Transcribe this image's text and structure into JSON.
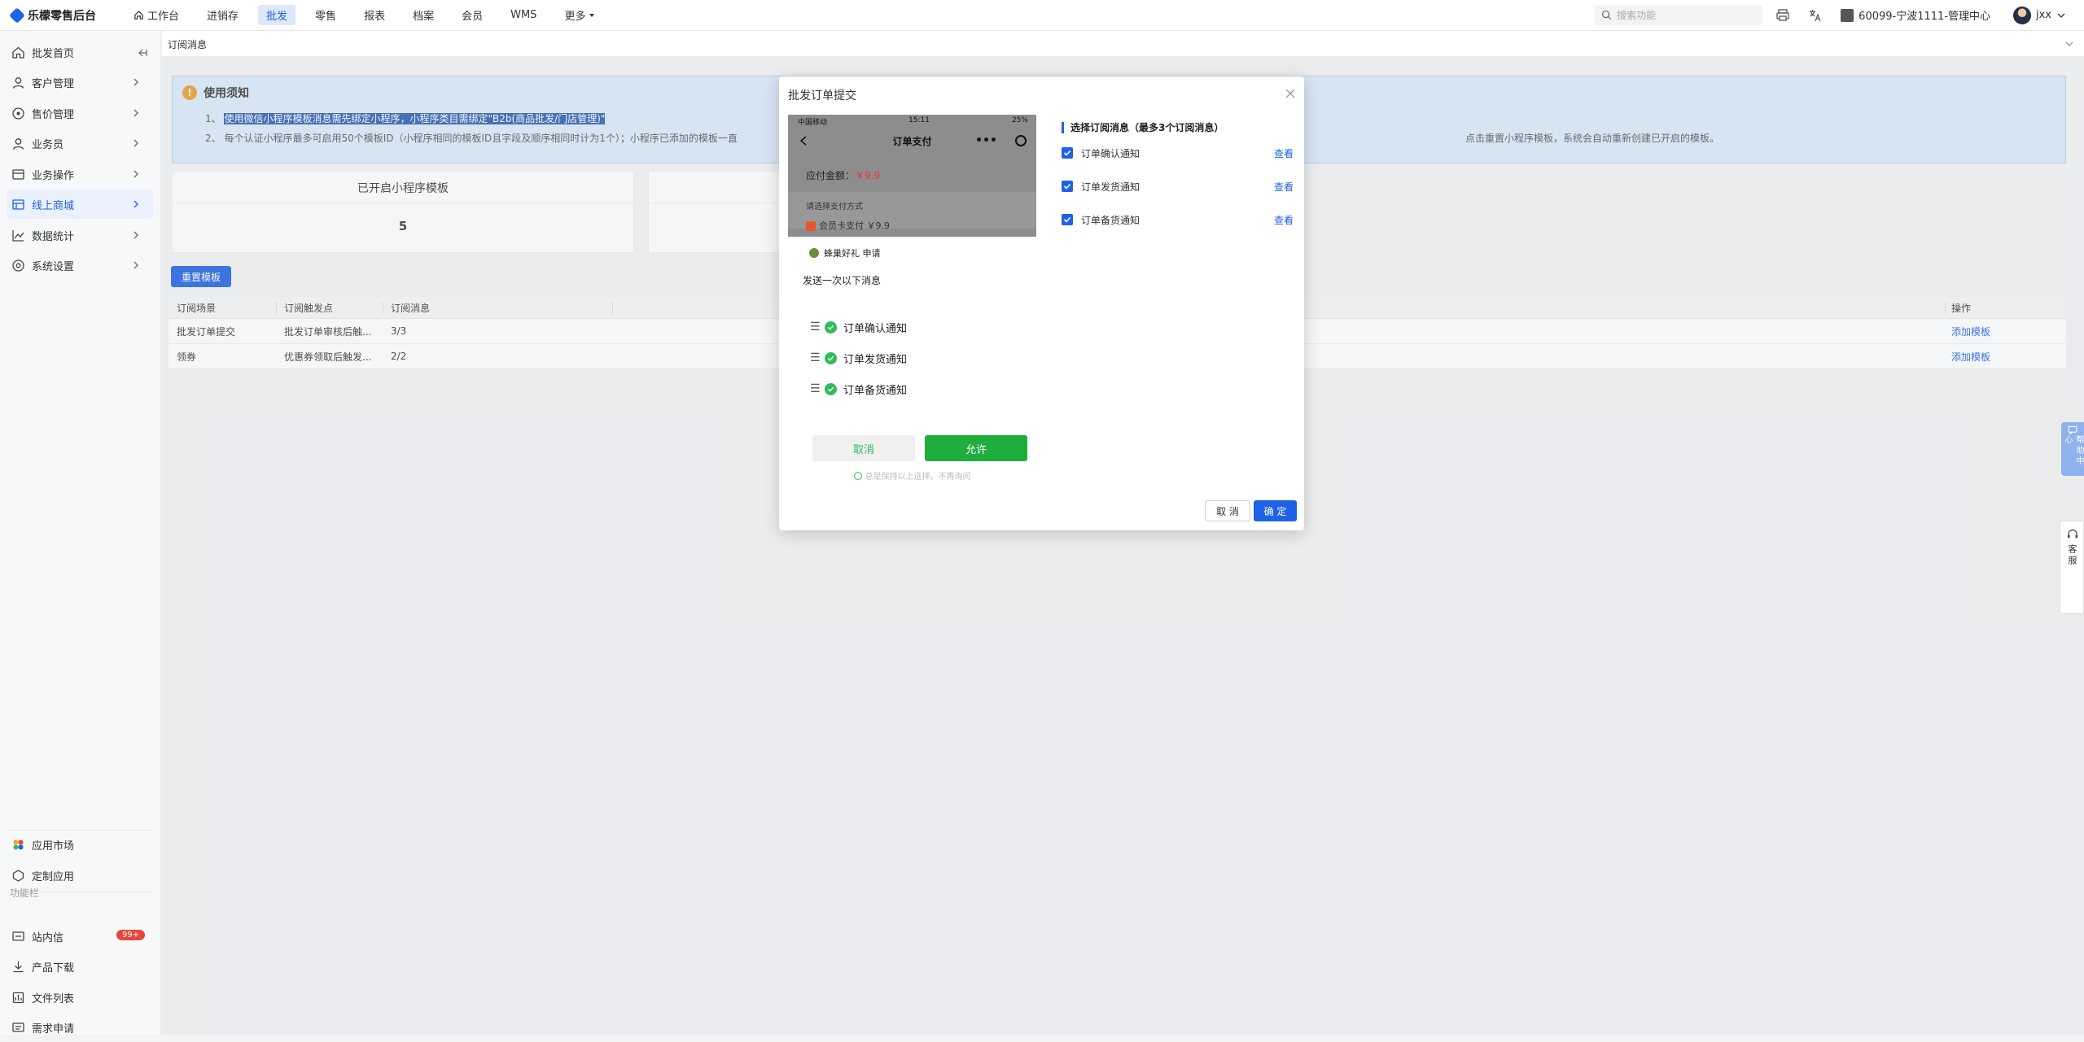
{
  "app": {
    "title": "乐檬零售后台"
  },
  "nav": [
    {
      "label": "工作台",
      "icon": "home-icon"
    },
    {
      "label": "进销存"
    },
    {
      "label": "批发",
      "active": true
    },
    {
      "label": "零售"
    },
    {
      "label": "报表"
    },
    {
      "label": "档案"
    },
    {
      "label": "会员"
    },
    {
      "label": "WMS"
    },
    {
      "label": "更多"
    }
  ],
  "header": {
    "search_placeholder": "搜索功能",
    "store": "60099-宁波1111-管理中心",
    "user": "jxx"
  },
  "sidebar": {
    "items": [
      {
        "label": "批发首页",
        "icon": "home-icon"
      },
      {
        "label": "客户管理",
        "icon": "user-icon"
      },
      {
        "label": "售价管理",
        "icon": "price-icon"
      },
      {
        "label": "业务员",
        "icon": "person-icon"
      },
      {
        "label": "业务操作",
        "icon": "ops-icon"
      },
      {
        "label": "线上商城",
        "icon": "shop-icon",
        "active": true
      },
      {
        "label": "数据统计",
        "icon": "chart-icon"
      },
      {
        "label": "系统设置",
        "icon": "settings-icon"
      }
    ],
    "bottom": [
      {
        "label": "应用市场",
        "icon": "market-icon"
      },
      {
        "label": "定制应用",
        "icon": "custom-app-icon"
      }
    ],
    "section_label": "功能栏",
    "tools": [
      {
        "label": "站内信",
        "icon": "message-icon",
        "badge": "99+"
      },
      {
        "label": "产品下载",
        "icon": "download-icon"
      },
      {
        "label": "文件列表",
        "icon": "file-icon"
      },
      {
        "label": "需求申请",
        "icon": "request-icon"
      }
    ]
  },
  "tab": {
    "label": "订阅消息"
  },
  "notice": {
    "title": "使用须知",
    "line1_prefix": "1、",
    "line1_highlight": "使用微信小程序模板消息需先绑定小程序，小程序类目需绑定\"B2b(商品批发/门店管理)\"",
    "line2_prefix": "2、",
    "line2_a": "每个认证小程序最多可启用50个模板ID（小程序相同的模板ID且字段及顺序相同时计为1个）；小程序已添加的模板一直",
    "line2_b": "点击重置小程序模板，系统会自动重新创建已开启的模板。"
  },
  "stats": [
    {
      "title": "已开启小程序模板",
      "value": "5"
    }
  ],
  "reset_button": "重置模板",
  "table": {
    "columns": [
      "订阅场景",
      "订阅触发点",
      "订阅消息",
      "操作"
    ],
    "rows": [
      {
        "scene": "批发订单提交",
        "trigger": "批发订单审核后触...",
        "msg": "3/3",
        "action": "添加模板"
      },
      {
        "scene": "领券",
        "trigger": "优惠券领取后触发...",
        "msg": "2/2",
        "action": "添加模板"
      }
    ]
  },
  "float": {
    "help": "帮助中心",
    "kefu": "客服"
  },
  "dialog": {
    "title": "批发订单提交",
    "phone": {
      "carrier": "中国移动",
      "time": "15:11",
      "battery": "25%",
      "page_title": "订单支付",
      "amount_label": "应付金额：",
      "amount": "￥9.9",
      "pay_method": "请选择支付方式",
      "pay_option": "会员卡支付 ￥9.9",
      "app_name": "蜂巢好礼 申请",
      "sheet_head": "发送一次以下消息",
      "perms": [
        "订单确认通知",
        "订单发货通知",
        "订单备货通知"
      ],
      "cancel": "取消",
      "allow": "允许",
      "keep": "总是保持以上选择，不再询问"
    },
    "panel_title": "选择订阅消息（最多3个订阅消息）",
    "options": [
      {
        "label": "订单确认通知",
        "view": "查看"
      },
      {
        "label": "订单发货通知",
        "view": "查看"
      },
      {
        "label": "订单备货通知",
        "view": "查看"
      }
    ],
    "cancel": "取 消",
    "ok": "确 定"
  }
}
